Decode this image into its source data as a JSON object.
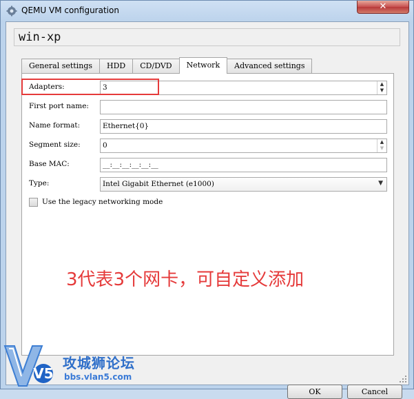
{
  "window": {
    "title": "QEMU VM configuration",
    "close_glyph": "✕",
    "icon": "gear-icon"
  },
  "vm_name": "win-xp",
  "tabs": [
    {
      "label": "General settings",
      "active": false
    },
    {
      "label": "HDD",
      "active": false
    },
    {
      "label": "CD/DVD",
      "active": false
    },
    {
      "label": "Network",
      "active": true
    },
    {
      "label": "Advanced settings",
      "active": false
    }
  ],
  "network": {
    "adapters": {
      "label": "Adapters:",
      "value": "3"
    },
    "first_port_name": {
      "label": "First port name:",
      "value": ""
    },
    "name_format": {
      "label": "Name format:",
      "value": "Ethernet{0}"
    },
    "segment_size": {
      "label": "Segment size:",
      "value": "0"
    },
    "base_mac": {
      "label": "Base MAC:",
      "value": "__:__:__:__:__:__"
    },
    "type": {
      "label": "Type:",
      "value": "Intel Gigabit Ethernet (e1000)"
    },
    "legacy_mode": {
      "label": "Use the legacy networking mode",
      "checked": false
    }
  },
  "annotation": "3代表3个网卡，可自定义添加",
  "buttons": {
    "ok": "OK",
    "cancel": "Cancel"
  },
  "watermark": {
    "cn_text": "攻城狮论坛",
    "url": "bbs.vlan5.com",
    "logo_text": "V5"
  },
  "colors": {
    "annotation_red": "#e53a3a",
    "watermark_blue": "#2f6fc9"
  }
}
